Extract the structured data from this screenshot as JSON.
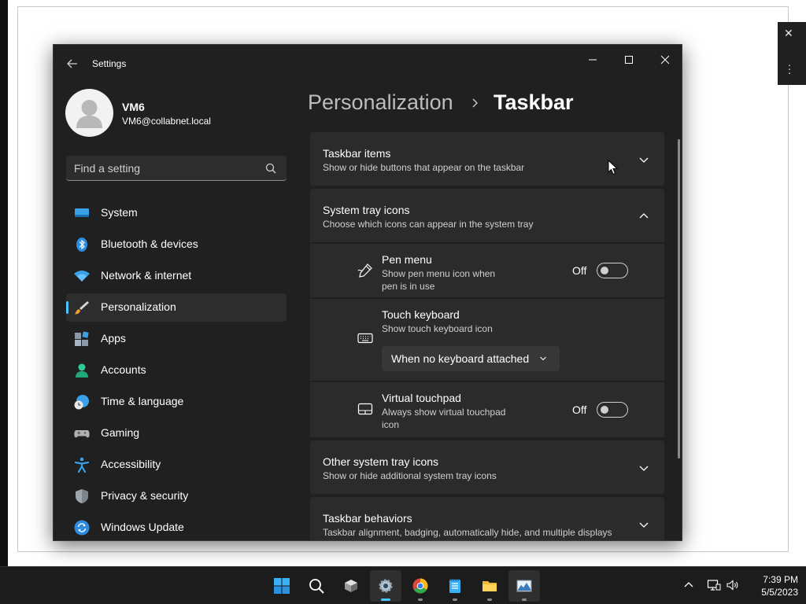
{
  "window": {
    "title": "Settings"
  },
  "profile": {
    "name": "VM6",
    "email": "VM6@collabnet.local"
  },
  "search": {
    "placeholder": "Find a setting"
  },
  "nav": [
    {
      "label": "System",
      "icon": "system-icon"
    },
    {
      "label": "Bluetooth & devices",
      "icon": "bluetooth-icon"
    },
    {
      "label": "Network & internet",
      "icon": "wifi-icon"
    },
    {
      "label": "Personalization",
      "icon": "brush-icon",
      "active": true
    },
    {
      "label": "Apps",
      "icon": "apps-icon"
    },
    {
      "label": "Accounts",
      "icon": "accounts-icon"
    },
    {
      "label": "Time & language",
      "icon": "clock-globe-icon"
    },
    {
      "label": "Gaming",
      "icon": "gamepad-icon"
    },
    {
      "label": "Accessibility",
      "icon": "accessibility-icon"
    },
    {
      "label": "Privacy & security",
      "icon": "shield-icon"
    },
    {
      "label": "Windows Update",
      "icon": "update-icon"
    }
  ],
  "breadcrumb": {
    "parent": "Personalization",
    "current": "Taskbar"
  },
  "sections": {
    "taskbar_items": {
      "title": "Taskbar items",
      "subtitle": "Show or hide buttons that appear on the taskbar",
      "expanded": false
    },
    "system_tray": {
      "title": "System tray icons",
      "subtitle": "Choose which icons can appear in the system tray",
      "expanded": true
    },
    "other_tray": {
      "title": "Other system tray icons",
      "subtitle": "Show or hide additional system tray icons",
      "expanded": false
    },
    "behaviors": {
      "title": "Taskbar behaviors",
      "subtitle": "Taskbar alignment, badging, automatically hide, and multiple displays",
      "expanded": false
    }
  },
  "tray_settings": {
    "pen_menu": {
      "title": "Pen menu",
      "desc": "Show pen menu icon when pen is in use",
      "state": "Off"
    },
    "touch_keyboard": {
      "title": "Touch keyboard",
      "desc": "Show touch keyboard icon",
      "value": "When no keyboard attached"
    },
    "virtual_touchpad": {
      "title": "Virtual touchpad",
      "desc": "Always show virtual touchpad icon",
      "state": "Off"
    }
  },
  "taskbar": {
    "apps": [
      "start-icon",
      "search-icon",
      "cube-app-icon",
      "settings-icon",
      "chrome-icon",
      "notepad-icon",
      "file-explorer-icon",
      "image-app-icon"
    ],
    "clock": {
      "time": "7:39 PM",
      "date": "5/5/2023"
    }
  },
  "colors": {
    "accent": "#4cc2ff",
    "window_bg": "#202020",
    "card_bg": "#2b2b2b"
  }
}
